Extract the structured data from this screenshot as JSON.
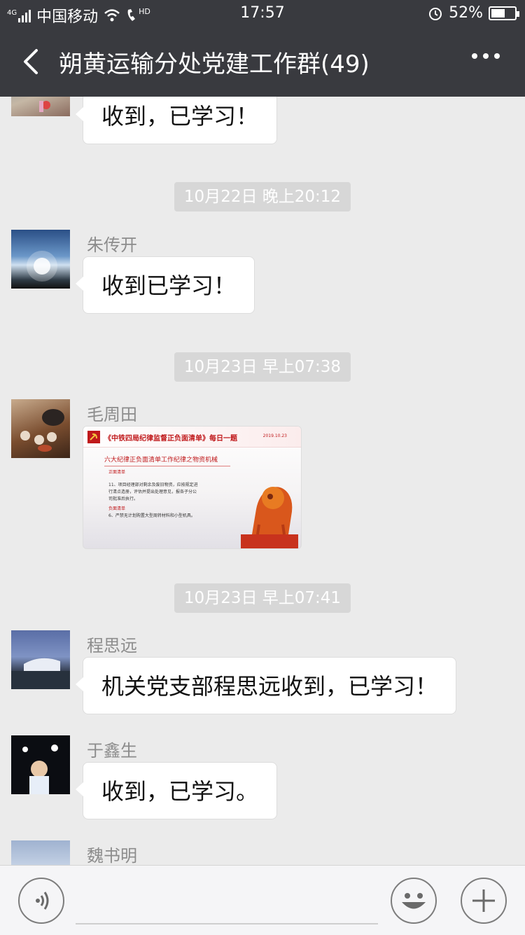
{
  "status_bar": {
    "network": "4G",
    "carrier": "中国移动",
    "hd": "HD",
    "time": "17:57",
    "battery_text": "52%",
    "battery_level": 0.52
  },
  "nav": {
    "title": "朔黄运输分处党建工作群(49)"
  },
  "messages": {
    "m0_text": "收到，已学习！",
    "t1": "10月22日 晚上20:12",
    "m1_name": "朱传开",
    "m1_text": "收到已学习！",
    "t2": "10月23日 早上07:38",
    "m2_name": "毛周田",
    "m2_image": {
      "title": "《中铁四局纪律监督正负面清单》每日一题",
      "date": "2019.10.23",
      "subtitle": "六大纪律正负面清单工作纪律之物资机械",
      "section1": "正面清单",
      "line1": "11、项目经理部对剩余及废旧物资，应按规定进",
      "line2": "行清点造册，评估并提出处理意见，报各子分公",
      "line3": "司批准后执行。",
      "section2": "负面清单",
      "line4": "6、严禁无计划购置大型周转材料和小型机具。"
    },
    "t3": "10月23日 早上07:41",
    "m3_name": "程思远",
    "m3_text": "机关党支部程思远收到，已学习！",
    "m4_name": "于鑫生",
    "m4_text": "收到，已学习。",
    "m5_name": "魏书明"
  },
  "colors": {
    "nav_bg": "#393a3f",
    "chat_bg": "#ebebeb",
    "bubble_bg": "#ffffff",
    "time_bg": "#d7d7d7",
    "name_text": "#8c8c8c"
  },
  "icons": [
    "back-arrow-icon",
    "more-icon",
    "voice-icon",
    "emoji-icon",
    "plus-icon",
    "signal-icon",
    "wifi-icon",
    "call-hd-icon",
    "alarm-icon",
    "battery-icon"
  ]
}
